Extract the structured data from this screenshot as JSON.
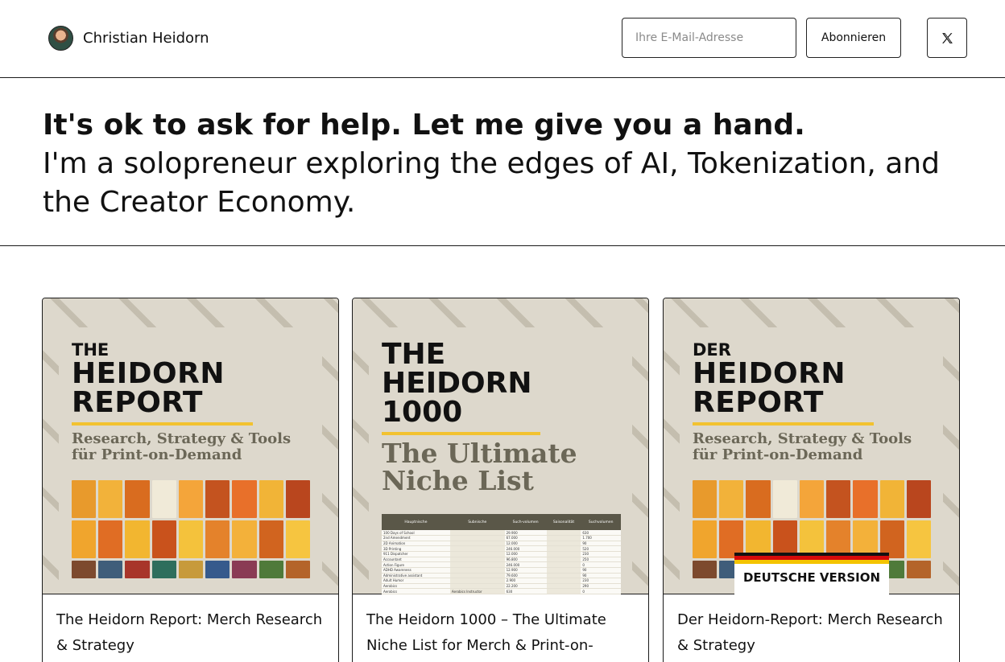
{
  "header": {
    "author_name": "Christian Heidorn",
    "email_placeholder": "Ihre E-Mail-Adresse",
    "subscribe_label": "Abonnieren",
    "x_icon": "x-logo-icon"
  },
  "hero": {
    "headline": "It's ok to ask for help. Let me give you a hand.",
    "tagline": "I'm a solopreneur exploring the edges of AI, Tokenization, and the Creator Economy."
  },
  "products": [
    {
      "title": "The Heidorn Report: Merch Research & Strategy",
      "cover": {
        "small": "THE",
        "line1": "HEIDORN",
        "line2": "REPORT",
        "sub1": "Research, Strategy & Tools",
        "sub2": "für Print-on-Demand"
      }
    },
    {
      "title": "The Heidorn 1000 – The Ultimate Niche List for Merch & Print-on-",
      "cover": {
        "line1": "THE",
        "line2": "HEIDORN",
        "line3": "1000",
        "sub1": "The Ultimate",
        "sub2": "Niche List",
        "table_headers": [
          "Hauptnische",
          "Subnische",
          "Such-volumen",
          "Saisonalität",
          "Suchvolumen"
        ],
        "table_rows": [
          [
            "100 Days of School",
            "",
            "29.900",
            "",
            "630"
          ],
          [
            "2nd Amendment",
            "",
            "67.000",
            "",
            "1.700"
          ],
          [
            "2D Animation",
            "",
            "12.000",
            "",
            "90"
          ],
          [
            "3D Printing",
            "",
            "246.000",
            "",
            "520"
          ],
          [
            "911 Dispatcher",
            "",
            "12.000",
            "",
            "230"
          ],
          [
            "Accountant",
            "",
            "96.800",
            "",
            "250"
          ],
          [
            "Action Figure",
            "",
            "246.000",
            "",
            "0"
          ],
          [
            "ADHD Awareness",
            "",
            "12.900",
            "",
            "90"
          ],
          [
            "Administrative assistant",
            "",
            "79.600",
            "",
            "90"
          ],
          [
            "Adult Humor",
            "",
            "2.900",
            "",
            "230"
          ],
          [
            "Aerobics",
            "",
            "22.200",
            "",
            "290"
          ],
          [
            "Aerobics",
            "Aerobics Instructor",
            "630",
            "",
            "0"
          ]
        ]
      }
    },
    {
      "title": "Der Heidorn-Report: Merch Research & Strategy",
      "cover": {
        "small": "DER",
        "line1": "HEIDORN",
        "line2": "REPORT",
        "sub1": "Research, Strategy & Tools",
        "sub2": "für Print-on-Demand",
        "badge": "DEUTSCHE VERSION"
      }
    }
  ],
  "colors": {
    "cover_bg": "#ddd8cc",
    "accent_yellow": "#f2c230",
    "subtitle_gray": "#6b6757",
    "border": "#1a1a1a"
  }
}
